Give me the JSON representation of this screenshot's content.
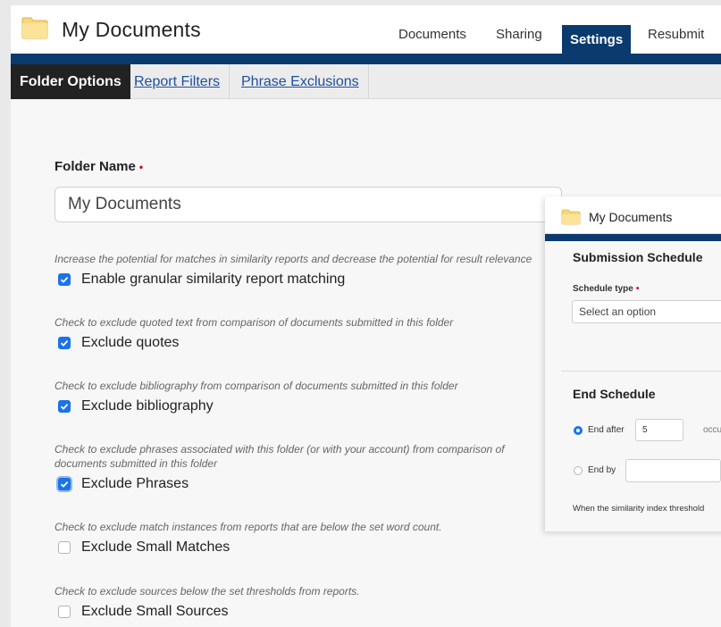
{
  "header": {
    "title": "My Documents",
    "tabs": [
      {
        "label": "Documents",
        "active": false
      },
      {
        "label": "Sharing",
        "active": false
      },
      {
        "label": "Settings",
        "active": true
      },
      {
        "label": "Resubmit",
        "active": false
      }
    ]
  },
  "subtabs": [
    {
      "label": "Folder Options",
      "active": true
    },
    {
      "label": "Report Filters",
      "active": false
    },
    {
      "label": "Phrase Exclusions",
      "active": false
    }
  ],
  "form": {
    "folder_name_label": "Folder Name",
    "required_mark": "•",
    "folder_name_value": "My Documents",
    "options": [
      {
        "hint": "Increase the potential for matches in similarity reports and decrease the potential for result relevance",
        "label": "Enable granular similarity report matching",
        "checked": true
      },
      {
        "hint": "Check to exclude quoted text from comparison of documents submitted in this folder",
        "label": "Exclude quotes",
        "checked": true
      },
      {
        "hint": "Check to exclude bibliography from comparison of documents submitted in this folder",
        "label": "Exclude bibliography",
        "checked": true
      },
      {
        "hint": "Check to exclude phrases associated with this folder (or with your account) from comparison of documents submitted in this folder",
        "label": "Exclude Phrases",
        "checked": true
      },
      {
        "hint": "Check to exclude match instances from reports that are below the set word count.",
        "label": "Exclude Small Matches",
        "checked": false
      },
      {
        "hint": "Check to exclude sources below the set thresholds from reports.",
        "label": "Exclude Small Sources",
        "checked": false
      }
    ]
  },
  "panel": {
    "title": "My Documents",
    "submission_heading": "Submission Schedule",
    "schedule_type_label": "Schedule type",
    "schedule_select_value": "Select an option",
    "end_heading": "End Schedule",
    "end_after_label": "End after",
    "end_after_value": "5",
    "end_after_suffix": "occu",
    "end_by_label": "End by",
    "end_by_value": "",
    "threshold_text": "When the similarity index threshold"
  },
  "colors": {
    "brand_blue": "#0b3a6e",
    "check_blue": "#1a73e8",
    "required_red": "#d0021b",
    "link_blue": "#1f4fa0"
  }
}
